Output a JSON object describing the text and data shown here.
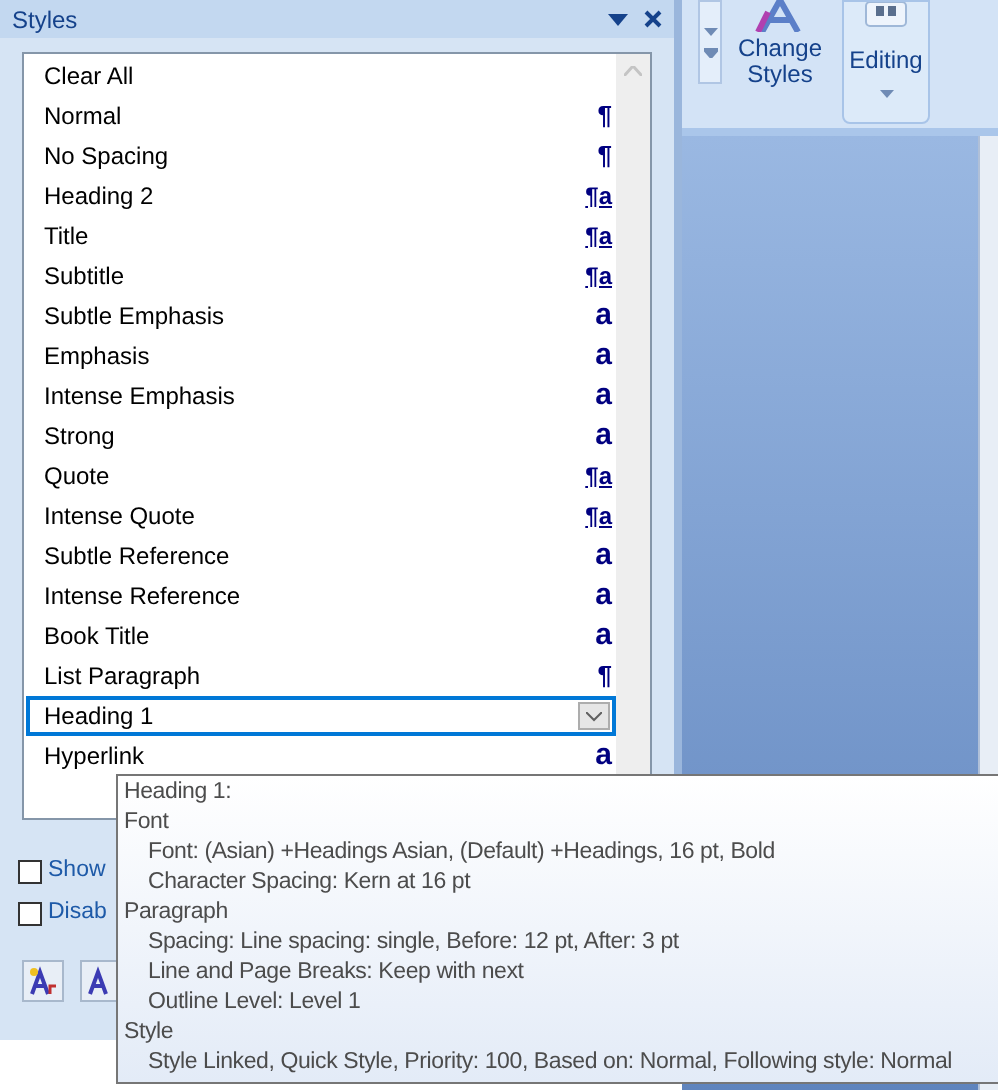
{
  "pane": {
    "title": "Styles",
    "styles": [
      {
        "name": "Clear All",
        "selected": false
      },
      {
        "name": "Normal",
        "kind": "paragraph",
        "symbol": "¶",
        "selected": false
      },
      {
        "name": "No Spacing",
        "kind": "paragraph",
        "symbol": "¶",
        "selected": false
      },
      {
        "name": "Heading 2",
        "kind": "linked",
        "symbol": "¶a",
        "selected": false
      },
      {
        "name": "Title",
        "kind": "linked",
        "symbol": "¶a",
        "selected": false
      },
      {
        "name": "Subtitle",
        "kind": "linked",
        "symbol": "¶a",
        "selected": false
      },
      {
        "name": "Subtle Emphasis",
        "kind": "character",
        "symbol": "a",
        "selected": false
      },
      {
        "name": "Emphasis",
        "kind": "character",
        "symbol": "a",
        "selected": false
      },
      {
        "name": "Intense Emphasis",
        "kind": "character",
        "symbol": "a",
        "selected": false
      },
      {
        "name": "Strong",
        "kind": "character",
        "symbol": "a",
        "selected": false
      },
      {
        "name": "Quote",
        "kind": "linked",
        "symbol": "¶a",
        "selected": false
      },
      {
        "name": "Intense Quote",
        "kind": "linked",
        "symbol": "¶a",
        "selected": false
      },
      {
        "name": "Subtle Reference",
        "kind": "character",
        "symbol": "a",
        "selected": false
      },
      {
        "name": "Intense Reference",
        "kind": "character",
        "symbol": "a",
        "selected": false
      },
      {
        "name": "Book Title",
        "kind": "character",
        "symbol": "a",
        "selected": false
      },
      {
        "name": "List Paragraph",
        "kind": "paragraph",
        "symbol": "¶",
        "selected": false
      },
      {
        "name": "Heading 1",
        "selected": true
      },
      {
        "name": "Hyperlink",
        "kind": "character",
        "symbol": "a",
        "selected": false
      }
    ],
    "options": [
      {
        "label": "Show",
        "checked": false
      },
      {
        "label": "Disab",
        "checked": false
      }
    ]
  },
  "ribbon": {
    "buttons": [
      "Change Styles",
      "Editing"
    ]
  },
  "tooltip": {
    "title": "Heading 1:",
    "sections": [
      {
        "heading": "Font",
        "children": [
          "Font:  (Asian) +Headings Asian, (Default) +Headings, 16 pt, Bold",
          "Character Spacing:  Kern at 16 pt"
        ]
      },
      {
        "heading": "Paragraph",
        "children": [
          "Spacing:  Line spacing:  single, Before:  12 pt, After:  3 pt",
          "Line and Page Breaks:  Keep with next",
          "Outline Level:  Level 1"
        ]
      },
      {
        "heading": "Style",
        "children": [
          "Style Linked, Quick Style, Priority: 100, Based on: Normal, Following style: Normal"
        ]
      }
    ]
  }
}
